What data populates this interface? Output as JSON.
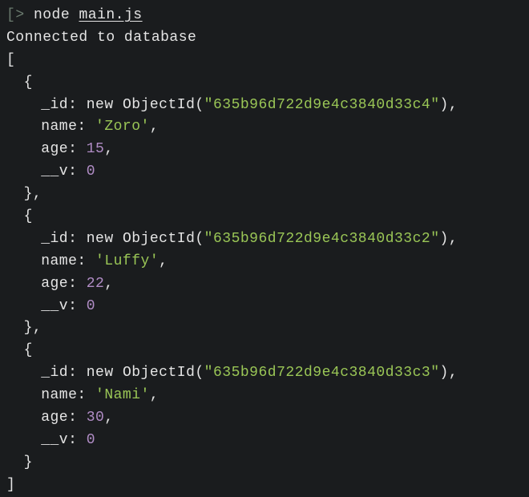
{
  "prompt": {
    "open_bracket": "[",
    "caret": ">",
    "command": "node",
    "filename": "main.js"
  },
  "output": {
    "connected_msg": "Connected to database",
    "array_open": "[",
    "array_close": "]",
    "records": [
      {
        "obj_open": "{",
        "id_key": "_id:",
        "id_kw_new": "new",
        "id_fn": "ObjectId(",
        "id_val": "\"635b96d722d9e4c3840d33c4\"",
        "id_close": "),",
        "name_key": "name:",
        "name_val": "'Zoro'",
        "name_comma": ",",
        "age_key": "age:",
        "age_val": "15",
        "age_comma": ",",
        "v_key": "__v:",
        "v_val": "0",
        "obj_close": "},"
      },
      {
        "obj_open": "{",
        "id_key": "_id:",
        "id_kw_new": "new",
        "id_fn": "ObjectId(",
        "id_val": "\"635b96d722d9e4c3840d33c2\"",
        "id_close": "),",
        "name_key": "name:",
        "name_val": "'Luffy'",
        "name_comma": ",",
        "age_key": "age:",
        "age_val": "22",
        "age_comma": ",",
        "v_key": "__v:",
        "v_val": "0",
        "obj_close": "},"
      },
      {
        "obj_open": "{",
        "id_key": "_id:",
        "id_kw_new": "new",
        "id_fn": "ObjectId(",
        "id_val": "\"635b96d722d9e4c3840d33c3\"",
        "id_close": "),",
        "name_key": "name:",
        "name_val": "'Nami'",
        "name_comma": ",",
        "age_key": "age:",
        "age_val": "30",
        "age_comma": ",",
        "v_key": "__v:",
        "v_val": "0",
        "obj_close": "}"
      }
    ]
  }
}
